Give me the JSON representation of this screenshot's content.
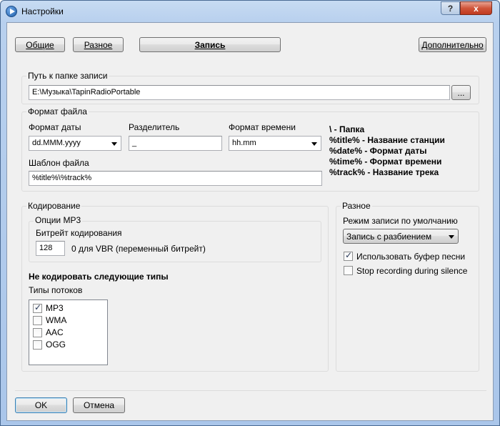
{
  "window": {
    "title": "Настройки",
    "help_label": "?",
    "close_label": "x"
  },
  "tabs": [
    {
      "label": "Общие",
      "active": false
    },
    {
      "label": "Разное",
      "active": false
    },
    {
      "label": "Запись",
      "active": true
    },
    {
      "label": "Дополнительно",
      "active": false
    }
  ],
  "record_folder": {
    "title": "Путь к папке записи",
    "path": "E:\\Музыка\\TapinRadioPortable",
    "browse_label": "..."
  },
  "file_format": {
    "title": "Формат файла",
    "date_format_label": "Формат даты",
    "date_format_value": "dd.MMM.yyyy",
    "separator_label": "Разделитель",
    "separator_value": "_",
    "time_format_label": "Формат времени",
    "time_format_value": "hh.mm",
    "template_label": "Шаблон файла",
    "template_value": "%title%\\%track%",
    "legend": [
      "\\ - Папка",
      "%title% - Название станции",
      "%date% - Формат даты",
      "%time% - Формат времени",
      "%track% - Название трека"
    ]
  },
  "encoding": {
    "title": "Кодирование",
    "mp3_options_title": "Опции MP3",
    "bitrate_label": "Битрейт кодирования",
    "bitrate_value": "128",
    "bitrate_hint": "0 для VBR (переменный битрейт)",
    "no_encode_title": "Не кодировать следующие типы",
    "stream_types_label": "Типы потоков",
    "stream_types": [
      {
        "label": "MP3",
        "checked": true
      },
      {
        "label": "WMA",
        "checked": false
      },
      {
        "label": "AAC",
        "checked": false
      },
      {
        "label": "OGG",
        "checked": false
      }
    ]
  },
  "misc": {
    "title": "Разное",
    "default_mode_label": "Режим записи по умолчанию",
    "default_mode_value": "Запись с разбиением",
    "use_song_buffer_label": "Использовать буфер песни",
    "use_song_buffer_checked": true,
    "stop_on_silence_label": "Stop recording during silence",
    "stop_on_silence_checked": false
  },
  "footer": {
    "ok_label": "OK",
    "cancel_label": "Отмена"
  }
}
